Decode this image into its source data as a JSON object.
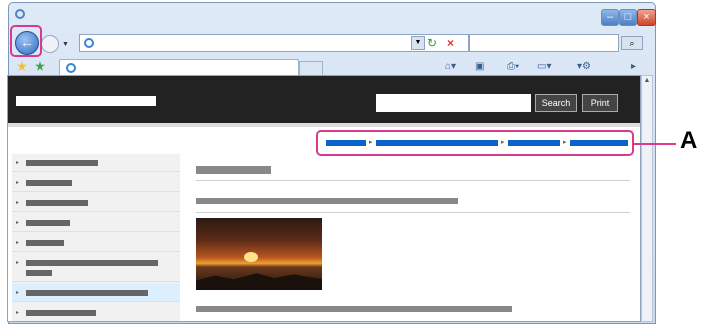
{
  "site": {
    "search_label": "Search",
    "print_label": "Print"
  },
  "callout": {
    "label": "A"
  },
  "colors": {
    "highlight": "#d93a8d",
    "breadcrumb": "#0b63c9",
    "site_header": "#222222"
  }
}
